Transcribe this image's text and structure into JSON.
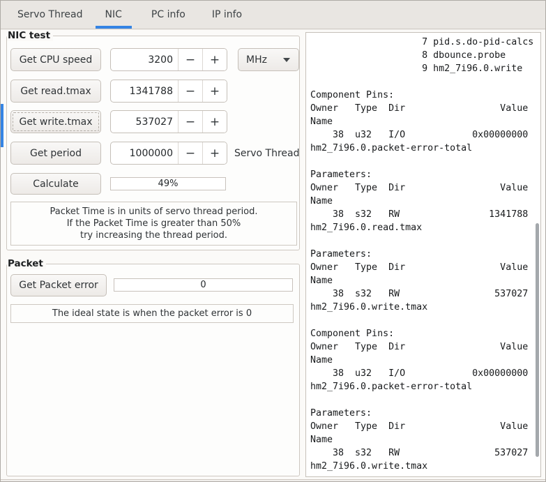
{
  "accent_color": "#3584e4",
  "tabs": [
    {
      "label": "Servo Thread",
      "active": false
    },
    {
      "label": "NIC",
      "active": true
    },
    {
      "label": "PC info",
      "active": false
    },
    {
      "label": "IP info",
      "active": false
    }
  ],
  "icons": {
    "minus": "−",
    "plus": "+"
  },
  "nic_test": {
    "label": "NIC test",
    "rows": [
      {
        "button": "Get CPU speed",
        "value": "3200",
        "unit": "MHz"
      },
      {
        "button": "Get read.tmax",
        "value": "1341788"
      },
      {
        "button": "Get write.tmax",
        "value": "537027"
      },
      {
        "button": "Get period",
        "value": "1000000",
        "suffix": "Servo Thread"
      }
    ],
    "calculate_button": "Calculate",
    "packet_time_value": "49%",
    "note_lines": [
      "Packet Time is in units of servo thread period.",
      "If the Packet Time is greater than 50%",
      "try increasing the thread period."
    ]
  },
  "packet": {
    "label": "Packet",
    "button": "Get Packet error",
    "error_value": "0",
    "note": "The ideal state is when the packet error is 0"
  },
  "terminal": {
    "text": "                    7 pid.s.do-pid-calcs\n                    8 dbounce.probe\n                    9 hm2_7i96.0.write\n\nComponent Pins:\nOwner   Type  Dir                 Value\nName\n    38  u32   I/O            0x00000000\nhm2_7i96.0.packet-error-total\n\nParameters:\nOwner   Type  Dir                 Value\nName\n    38  s32   RW                1341788\nhm2_7i96.0.read.tmax\n\nParameters:\nOwner   Type  Dir                 Value\nName\n    38  s32   RW                 537027\nhm2_7i96.0.write.tmax\n\nComponent Pins:\nOwner   Type  Dir                 Value\nName\n    38  u32   I/O            0x00000000\nhm2_7i96.0.packet-error-total\n\nParameters:\nOwner   Type  Dir                 Value\nName\n    38  s32   RW                 537027\nhm2_7i96.0.write.tmax"
  }
}
